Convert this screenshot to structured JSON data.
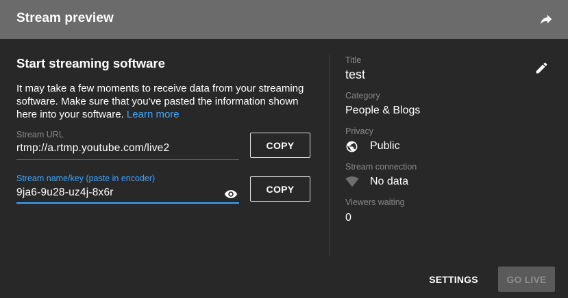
{
  "header": {
    "title": "Stream preview",
    "share_icon": "share-arrow-icon"
  },
  "setup": {
    "title": "Start streaming software",
    "description": "It may take a few moments to receive data from your streaming software. Make sure that you've pasted the information shown here into your software.",
    "learn_more": "Learn more",
    "stream_url": {
      "label": "Stream URL",
      "value": "rtmp://a.rtmp.youtube.com/live2",
      "copy_label": "COPY"
    },
    "stream_key": {
      "label": "Stream name/key (paste in encoder)",
      "value": "9ja6-9u28-uz4j-8x6r",
      "copy_label": "COPY",
      "reveal_icon": "eye-icon"
    }
  },
  "details": {
    "title_label": "Title",
    "title_value": "test",
    "edit_icon": "pencil-icon",
    "category_label": "Category",
    "category_value": "People & Blogs",
    "privacy_label": "Privacy",
    "privacy_value": "Public",
    "privacy_icon": "globe-icon",
    "connection_label": "Stream connection",
    "connection_value": "No data",
    "connection_icon": "wifi-signal-icon",
    "viewers_label": "Viewers waiting",
    "viewers_value": "0"
  },
  "footer": {
    "settings_label": "SETTINGS",
    "go_live_label": "GO LIVE"
  },
  "colors": {
    "background": "#282828",
    "header": "#6b6b6b",
    "accent": "#3ea6ff",
    "muted_text": "#8a8a8a"
  }
}
